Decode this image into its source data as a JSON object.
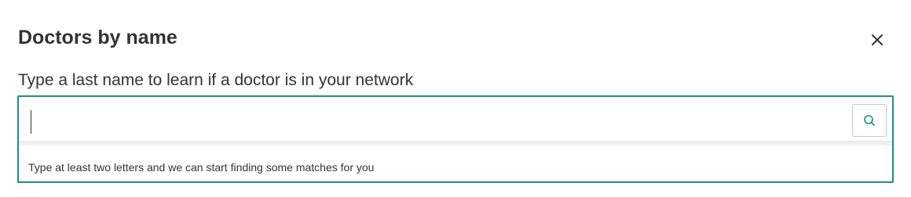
{
  "dialog": {
    "title": "Doctors by name",
    "close_icon": "close-icon"
  },
  "search": {
    "label": "Type a last name to learn if a doctor is in your network",
    "value": "",
    "placeholder": "",
    "button_icon": "search-icon",
    "hint": "Type at least two letters and we can start finding some matches for you"
  },
  "colors": {
    "accent": "#1a9080",
    "text": "#333333",
    "button_border": "#c8c8c8"
  }
}
